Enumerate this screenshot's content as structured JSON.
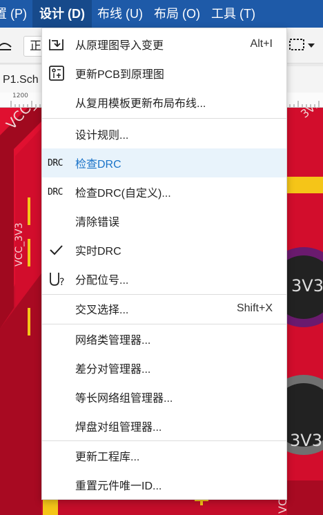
{
  "menubar": {
    "items": [
      {
        "label": "置 (P)"
      },
      {
        "label": "设计 (D)"
      },
      {
        "label": "布线 (U)"
      },
      {
        "label": "布局 (O)"
      },
      {
        "label": "工具 (T)"
      }
    ]
  },
  "toolbar": {
    "select_value": "正"
  },
  "tabs": {
    "active": "P1.Sch"
  },
  "ruler": {
    "label": "1200"
  },
  "pcb": {
    "net_label_1": "VCC_",
    "net_label_2": "VCC_3V3",
    "net_label_3": "3V3",
    "net_label_4": "3V3",
    "net_label_5": "3V3",
    "net_label_6": "VCC"
  },
  "design_menu": {
    "items": [
      {
        "label": "从原理图导入变更",
        "shortcut": "Alt+I",
        "icon": "import-icon"
      },
      {
        "label": "更新PCB到原理图",
        "icon": "update-pcb-icon"
      },
      {
        "label": "从复用模板更新布局布线..."
      },
      {
        "label": "设计规则..."
      },
      {
        "label": "检查DRC",
        "icon_text": "DRC"
      },
      {
        "label": "检查DRC(自定义)...",
        "icon_text": "DRC"
      },
      {
        "label": "清除错误"
      },
      {
        "label": "实时DRC",
        "icon": "checkmark-icon"
      },
      {
        "label": "分配位号...",
        "icon": "assign-designator-icon"
      },
      {
        "label": "交叉选择...",
        "shortcut": "Shift+X"
      },
      {
        "label": "网络类管理器..."
      },
      {
        "label": "差分对管理器..."
      },
      {
        "label": "等长网络组管理器..."
      },
      {
        "label": "焊盘对组管理器..."
      },
      {
        "label": "更新工程库..."
      },
      {
        "label": "重置元件唯一ID..."
      }
    ]
  },
  "colors": {
    "menubar": "#1e5aa8",
    "highlight": "#e8f3fb",
    "pcb_red": "#c40d2a",
    "pcb_dark": "#a0091f",
    "trace_yellow": "#f5c518"
  }
}
